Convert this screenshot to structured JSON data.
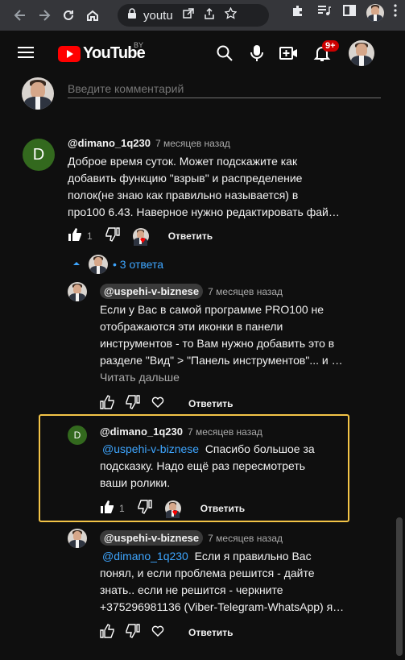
{
  "browser": {
    "url": "youtu",
    "nav": {
      "back": "back-arrow",
      "forward": "forward-arrow",
      "reload": "reload",
      "home": "home"
    }
  },
  "header": {
    "logo_text": "YouTube",
    "country_code": "BY",
    "notification_count": "9+"
  },
  "comment_box": {
    "placeholder": "Введите комментарий"
  },
  "comments": [
    {
      "avatar_letter": "D",
      "author": "@dimano_1q230",
      "time": "7 месяцев назад",
      "text_lines": [
        "Доброе время суток. Может подскажите как",
        "добавить функцию \"взрыв\" и распределение",
        "полок(не знаю как правильно называется) в",
        "про100 6.43. Наверное нужно редактировать фай…"
      ],
      "likes": "1",
      "reply_label": "Ответить"
    }
  ],
  "replies_toggle": {
    "label": "3 ответа"
  },
  "replies": [
    {
      "author": "@uspehi-v-biznese",
      "time": "7 месяцев назад",
      "text_lines": [
        "Если у Вас в самой программе PRO100 не",
        "отображаются эти иконки в панели",
        "инструментов - то Вам нужно добавить это в",
        "разделе \"Вид\" > \"Панель инструментов\"... и …"
      ],
      "read_more": "Читать дальше",
      "reply_label": "Ответить"
    },
    {
      "avatar_letter": "D",
      "author": "@dimano_1q230",
      "time": "7 месяцев назад",
      "mention": "@uspehi-v-biznese",
      "text_first_rest": "  Спасибо большое за",
      "text_lines": [
        "подсказку. Надо ещё раз пересмотреть",
        "ваши ролики."
      ],
      "likes": "1",
      "reply_label": "Ответить"
    },
    {
      "author": "@uspehi-v-biznese",
      "time": "7 месяцев назад",
      "mention": "@dimano_1q230",
      "text_first_rest": "  Если я правильно Вас",
      "text_lines": [
        "понял, и если проблема решится - дайте",
        "знать.. если не решится - черкните",
        "+375296981136 (Viber-Telegram-WhatsApp) я…"
      ],
      "reply_label": "Ответить"
    }
  ],
  "colors": {
    "background": "#0f0f0f",
    "link": "#3ea6ff",
    "highlight_border": "#f3c447",
    "avatar_green": "#33691e",
    "brand_red": "#ff0000"
  }
}
